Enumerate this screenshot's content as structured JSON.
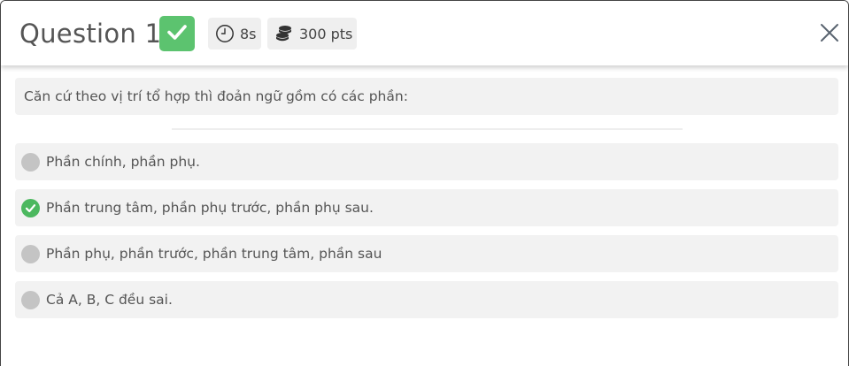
{
  "header": {
    "title": "Question 1",
    "status_icon": "check-icon",
    "time_label": "8s",
    "time_icon": "clock-icon",
    "points_label": "300 pts",
    "points_icon": "coins-icon",
    "close_icon": "close-icon"
  },
  "question": {
    "text": "Căn cứ theo vị trí tổ hợp thì đoản ngữ gồm có các phần:"
  },
  "options": [
    {
      "label": "Phần chính, phần phụ.",
      "state": "unselected"
    },
    {
      "label": "Phần trung tâm, phần phụ trước, phần phụ sau.",
      "state": "correct"
    },
    {
      "label": "Phần phụ, phần trước, phần trung tâm, phần sau",
      "state": "unselected"
    },
    {
      "label": "Cả A, B, C đều sai.",
      "state": "unselected"
    }
  ],
  "colors": {
    "correct_green": "#5cc36f",
    "marker_gray": "#c4c4c4",
    "row_background": "#f2f2f2"
  }
}
